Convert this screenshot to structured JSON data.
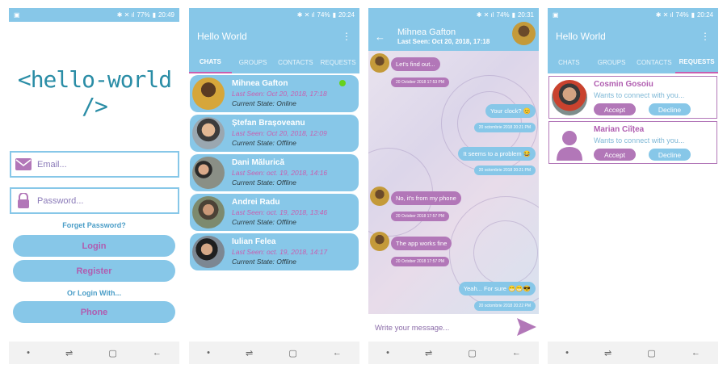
{
  "status": {
    "s1": {
      "battery": "77%",
      "time": "20:49"
    },
    "s2": {
      "battery": "74%",
      "time": "20:24"
    },
    "s3": {
      "battery": "74%",
      "time": "20:31"
    },
    "s4": {
      "battery": "74%",
      "time": "20:24"
    }
  },
  "login": {
    "logo": "<hello-world />",
    "email_placeholder": "Email...",
    "password_placeholder": "Password...",
    "forget": "Forget Password?",
    "login_label": "Login",
    "register_label": "Register",
    "or_login": "Or Login With...",
    "phone_label": "Phone"
  },
  "app": {
    "title": "Hello World",
    "tabs": [
      "CHATS",
      "GROUPS",
      "CONTACTS",
      "REQUESTS"
    ]
  },
  "chats": [
    {
      "name": "Mihnea Gafton",
      "seen": "Last Seen: Oct 20, 2018, 17:18",
      "state": "Current State: Online"
    },
    {
      "name": "Ștefan Brașoveanu",
      "seen": "Last Seen: Oct 20, 2018, 12:09",
      "state": "Current State: Offline"
    },
    {
      "name": "Dani Mălurică",
      "seen": "Last Seen: oct. 19, 2018, 14:16",
      "state": "Current State: Offline"
    },
    {
      "name": "Andrei Radu",
      "seen": "Last Seen: oct. 19, 2018, 13:46",
      "state": "Current State: Offline"
    },
    {
      "name": "Iulian Felea",
      "seen": "Last Seen: oct. 19, 2018, 14:17",
      "state": "Current State: Offline"
    }
  ],
  "conversation": {
    "name": "Mihnea Gafton",
    "last_seen": "Last Seen: Oct 20, 2018, 17:18",
    "messages": [
      {
        "text": "Let's find out...",
        "time": "20 October 2018 17:53 PM"
      },
      {
        "text": "Your clock? 😊",
        "time": "20 octombrie 2018 20:21 PM"
      },
      {
        "text": "It seems to a problem 😂",
        "time": "20 octombrie 2018 20:21 PM"
      },
      {
        "text": "No, it's from my phone",
        "time": "20 October 2018 17:57 PM"
      },
      {
        "text": "The app works fine",
        "time": "20 October 2018 17:57 PM"
      },
      {
        "text": "Yeah... For sure 😁😁😎",
        "time": "20 octombrie 2018 20:22 PM"
      }
    ],
    "composer_placeholder": "Write your message..."
  },
  "requests": [
    {
      "name": "Cosmin Gosoiu",
      "text": "Wants to connect with you...",
      "accept": "Accept",
      "decline": "Decline"
    },
    {
      "name": "Marian Ciîțea",
      "text": "Wants to connect with you...",
      "accept": "Accept",
      "decline": "Decline"
    }
  ],
  "colors": {
    "primary": "#87c7e8",
    "accent": "#b277b8",
    "pink_text": "#c85fb0",
    "online": "#66d21d"
  }
}
